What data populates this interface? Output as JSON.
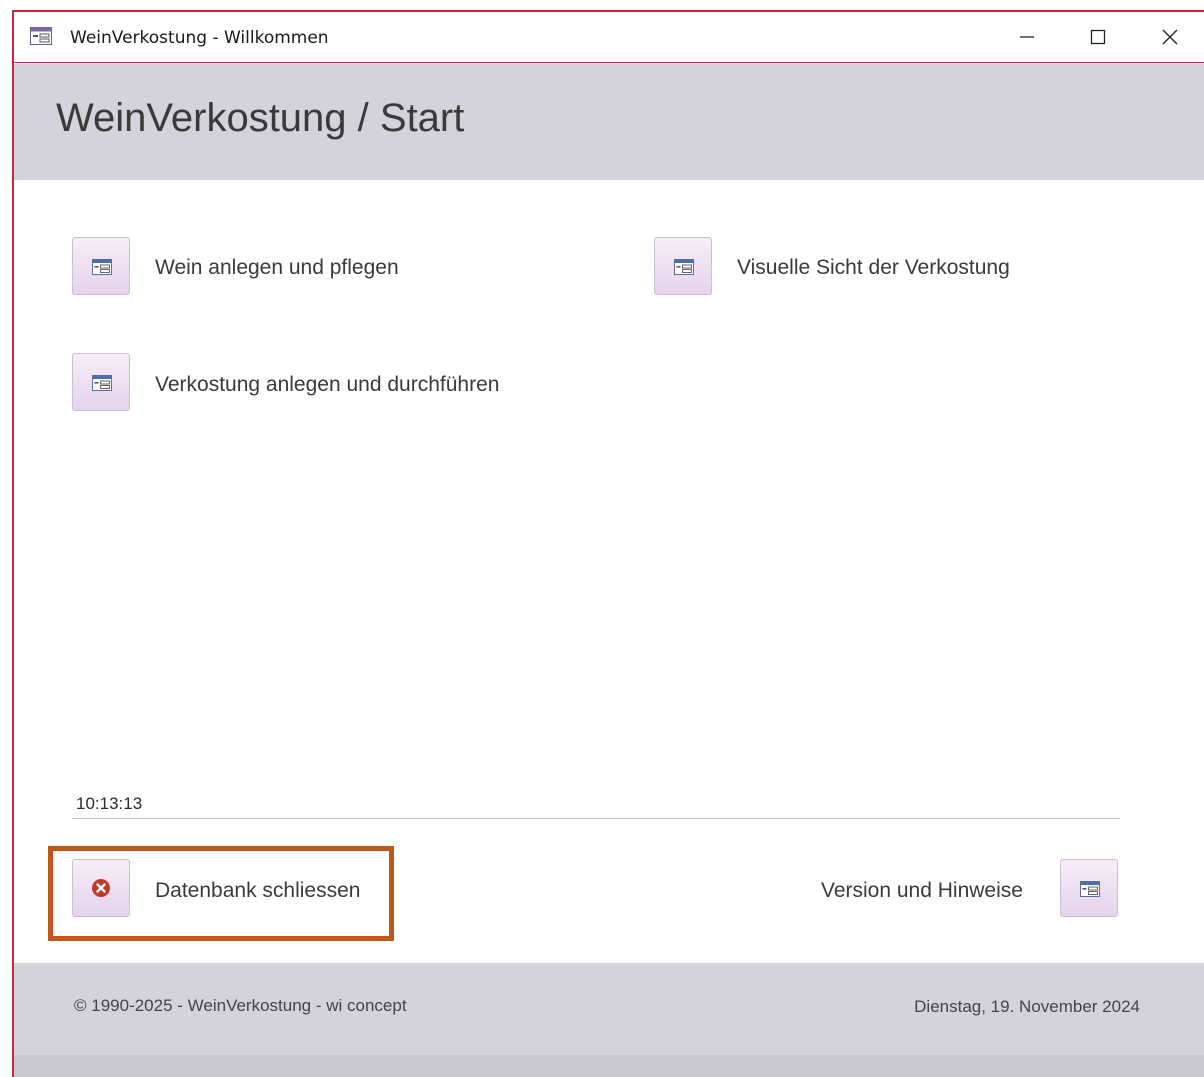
{
  "window": {
    "title": "WeinVerkostung - Willkommen",
    "controls": {
      "minimize": "—",
      "maximize": "☐",
      "close": "✕"
    }
  },
  "header": {
    "title": "WeinVerkostung / Start"
  },
  "menu": {
    "wein": {
      "label": "Wein anlegen und pflegen",
      "icon": "form-icon"
    },
    "visual": {
      "label": "Visuelle Sicht der Verkostung",
      "icon": "form-icon"
    },
    "verkostung": {
      "label": "Verkostung anlegen und durchführen",
      "icon": "form-icon"
    }
  },
  "clock": {
    "time": "10:13:13"
  },
  "actions": {
    "close_db": {
      "label": "Datenbank schliessen",
      "icon": "close-circle-icon"
    },
    "version": {
      "label": "Version und Hinweise",
      "icon": "form-icon"
    }
  },
  "footer": {
    "copyright": "© 1990-2025 - WeinVerkostung - wi concept",
    "date": "Dienstag, 19. November 2024"
  },
  "colors": {
    "window_border": "#c42b3c",
    "header_bg": "#d4d3dc",
    "button_bg": "#e6d2ec",
    "highlight": "#c0571a",
    "close_icon": "#c0392b"
  }
}
